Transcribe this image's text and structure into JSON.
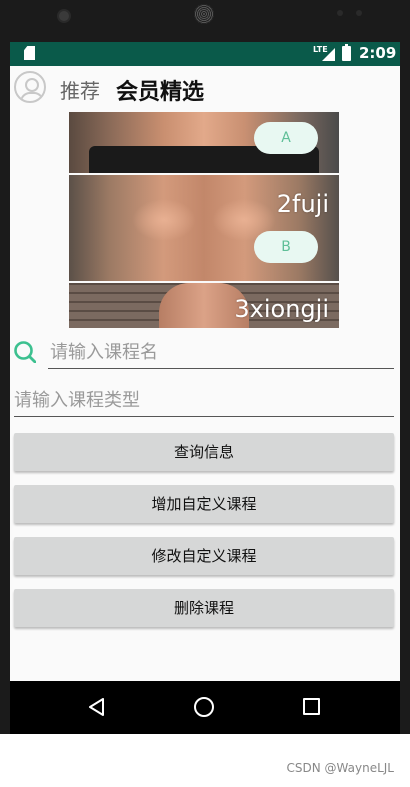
{
  "status_bar": {
    "time": "2:09",
    "network": "LTE"
  },
  "header": {
    "tab_recommend": "推荐",
    "tab_vip": "会员精选"
  },
  "banner": {
    "pill_a": "A",
    "pill_b": "B",
    "caption_2": "2fuji",
    "caption_3": "3xiongji"
  },
  "form": {
    "course_name_placeholder": "请输入课程名",
    "course_type_placeholder": "请输入课程类型"
  },
  "buttons": {
    "query": "查询信息",
    "add": "增加自定义课程",
    "edit": "修改自定义课程",
    "delete": "删除课程"
  },
  "watermark": "CSDN @WayneLJL",
  "colors": {
    "status_bar": "#0a5a4a",
    "accent": "#3cc08f",
    "button": "#d6d7d7"
  }
}
